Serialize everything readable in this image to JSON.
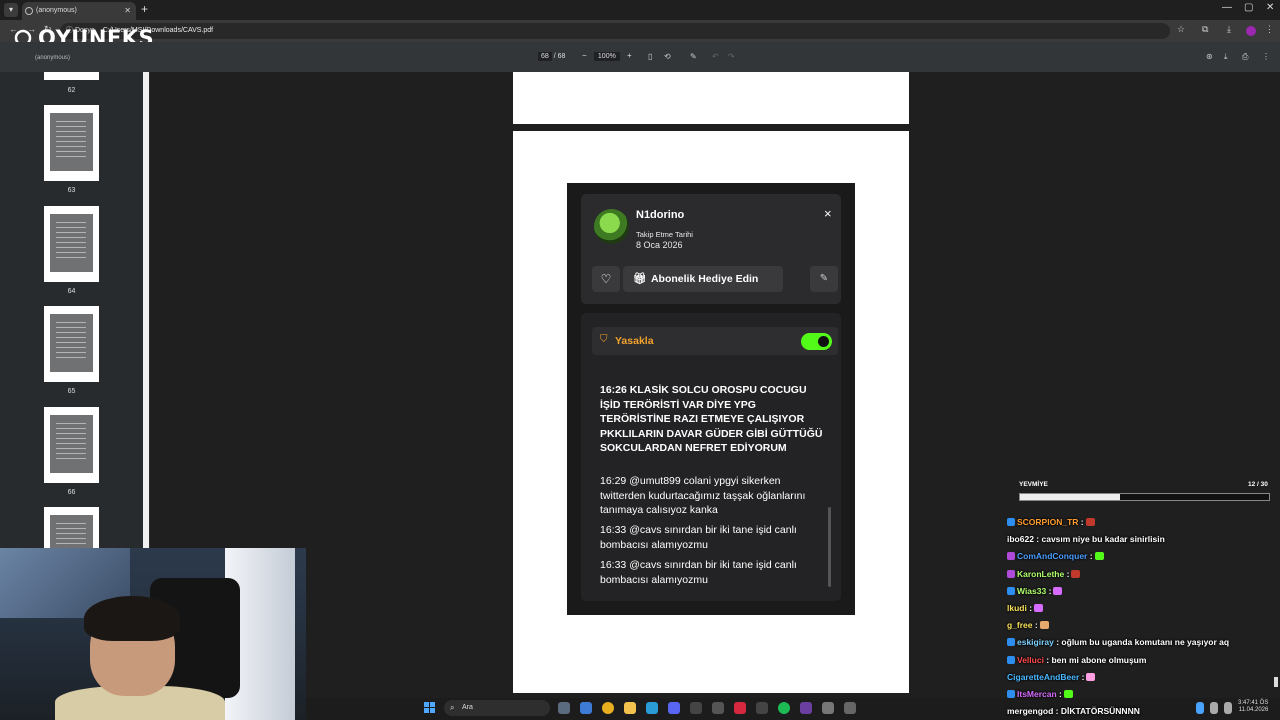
{
  "browser": {
    "tab_title": "(anonymous)",
    "tab_menu_icon": "chevron-down-icon",
    "new_tab": "+",
    "address_chip": "Dosya",
    "url": "C:/Users/MSI/Downloads/CAVS.pdf"
  },
  "overlay": {
    "logo_text": "OYUNEKS",
    "anon_label": "(anonymous)"
  },
  "pdf_toolbar": {
    "page_current": "68",
    "page_total": "/ 68",
    "zoom_out": "−",
    "zoom_value": "100%",
    "zoom_in": "+"
  },
  "thumbnails": [
    {
      "label": "62"
    },
    {
      "label": "63"
    },
    {
      "label": "64"
    },
    {
      "label": "65"
    },
    {
      "label": "66"
    }
  ],
  "user_card": {
    "username": "N1dorino",
    "follow_label": "Takip Etme Tarihi",
    "follow_date": "8 Oca 2026",
    "close_icon": "×",
    "heart_icon": "♡",
    "gift_label": "Abonelik Hediye Edin",
    "ban_label": "Yasakla",
    "ban_enabled": true,
    "toggle_color": "#53fc18",
    "ban_color": "#f2a22c",
    "messages": [
      {
        "time": "16:26",
        "text": "16:26 KLASİK SOLCU OROSPU COCUGU İŞİD TERÖRİSTİ VAR DİYE YPG TERÖRİSTİNE RAZI ETMEYE ÇALIŞIYOR PKKLILARIN DAVAR GÜDER GİBİ GÜTTÜĞÜ SOKCULARDAN NEFRET EDİYORUM"
      },
      {
        "time": "16:29",
        "text": "16:29 @umut899 colani ypgyi sikerken twitterden kudurtacağımız taşşak oğlanlarını tanımaya calısıyoz kanka"
      },
      {
        "time": "16:33",
        "text": "16:33 @cavs sınırdan bir iki tane işid canlı bombacısı alamıyozmu"
      },
      {
        "time": "16:33",
        "text": "16:33 @cavs sınırdan bir iki tane işid canlı bombacısı alamıyozmu"
      }
    ]
  },
  "taskbar": {
    "search_placeholder": "Ara",
    "time": "3:47:41 ÖS",
    "date": "11.04.2026"
  },
  "stream_chat": {
    "goal_label": "YEVMİYE",
    "goal_count": "12 / 30",
    "goal_progress": 0.4,
    "messages": [
      {
        "user": "SCORPION_TR",
        "color": "#ff9d2e",
        "text": ":",
        "badge": "#2e8ef0",
        "emote": "#c0392b"
      },
      {
        "user": "ibo622",
        "color": "#ffffff",
        "text": ": cavsım niye bu kadar sinirlisin",
        "badge": "",
        "emote": ""
      },
      {
        "user": "ComAndConquer",
        "color": "#4a9cff",
        "text": ":",
        "badge": "#b04ad9",
        "emote": "#53fc18"
      },
      {
        "user": "KaronLethe",
        "color": "#b0ff6e",
        "text": ":",
        "badge": "#b04ad9",
        "emote": "#c0392b"
      },
      {
        "user": "Wias33",
        "color": "#b0ff6e",
        "text": ":",
        "badge": "#2e8ef0",
        "emote": "#d66bff"
      },
      {
        "user": "lkudi",
        "color": "#f7e05c",
        "text": ":",
        "badge": "",
        "emote": "#d66bff"
      },
      {
        "user": "g_free",
        "color": "#f7e05c",
        "text": ":",
        "badge": "",
        "emote": "#e6a96b"
      },
      {
        "user": "eskigiray",
        "color": "#7fd1ff",
        "text": ": oğlum bu uganda komutanı ne yaşıyor aq",
        "badge": "#2e8ef0",
        "emote": ""
      },
      {
        "user": "Velluci",
        "color": "#ff4a4a",
        "text": ": ben mi abone olmuşum",
        "badge": "#2e8ef0",
        "emote": ""
      },
      {
        "user": "CigaretteAndBeer",
        "color": "#4ab8ff",
        "text": ":",
        "badge": "",
        "emote": "#ff9ee0"
      },
      {
        "user": "ItsMercan",
        "color": "#d66bff",
        "text": ":",
        "badge": "#2e8ef0",
        "emote": "#53fc18"
      },
      {
        "user": "mergengod",
        "color": "#ffffff",
        "text": ": DİKTATÖRSÜNNNN",
        "badge": "",
        "emote": ""
      }
    ]
  }
}
